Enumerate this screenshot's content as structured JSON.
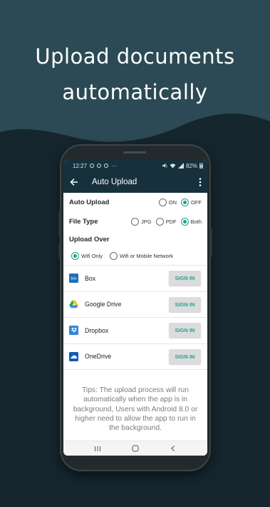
{
  "promo": {
    "line1": "Upload documents",
    "line2": "automatically"
  },
  "status_bar": {
    "time": "12:27",
    "more": "···",
    "battery": "82%"
  },
  "app_bar": {
    "title": "Auto Upload",
    "back_icon": "arrow-left-icon",
    "menu_icon": "more-vert-icon"
  },
  "settings": {
    "auto_upload": {
      "label": "Auto Upload",
      "options": [
        "ON",
        "OFF"
      ],
      "selected": "OFF"
    },
    "file_type": {
      "label": "File Type",
      "options": [
        "JPG",
        "PDF",
        "Both"
      ],
      "selected": "Both"
    },
    "upload_over": {
      "label": "Upload Over",
      "options": [
        "Wifi Only",
        "Wifi or Mobile Network"
      ],
      "selected": "Wifi Only"
    }
  },
  "services": [
    {
      "name": "Box",
      "button": "SIGN IN",
      "icon": "box-icon"
    },
    {
      "name": "Google Drive",
      "button": "SIGN IN",
      "icon": "google-drive-icon"
    },
    {
      "name": "Dropbox",
      "button": "SIGN IN",
      "icon": "dropbox-icon"
    },
    {
      "name": "OneDrive",
      "button": "SIGN IN",
      "icon": "onedrive-icon"
    }
  ],
  "tips": "Tips: The upload process will run automatically when the app is in background, Users with Android 8.0 or higher need to allow the app to run in the background.",
  "colors": {
    "accent": "#1e9f8c",
    "appbar": "#17313c",
    "background": "#16262e"
  }
}
